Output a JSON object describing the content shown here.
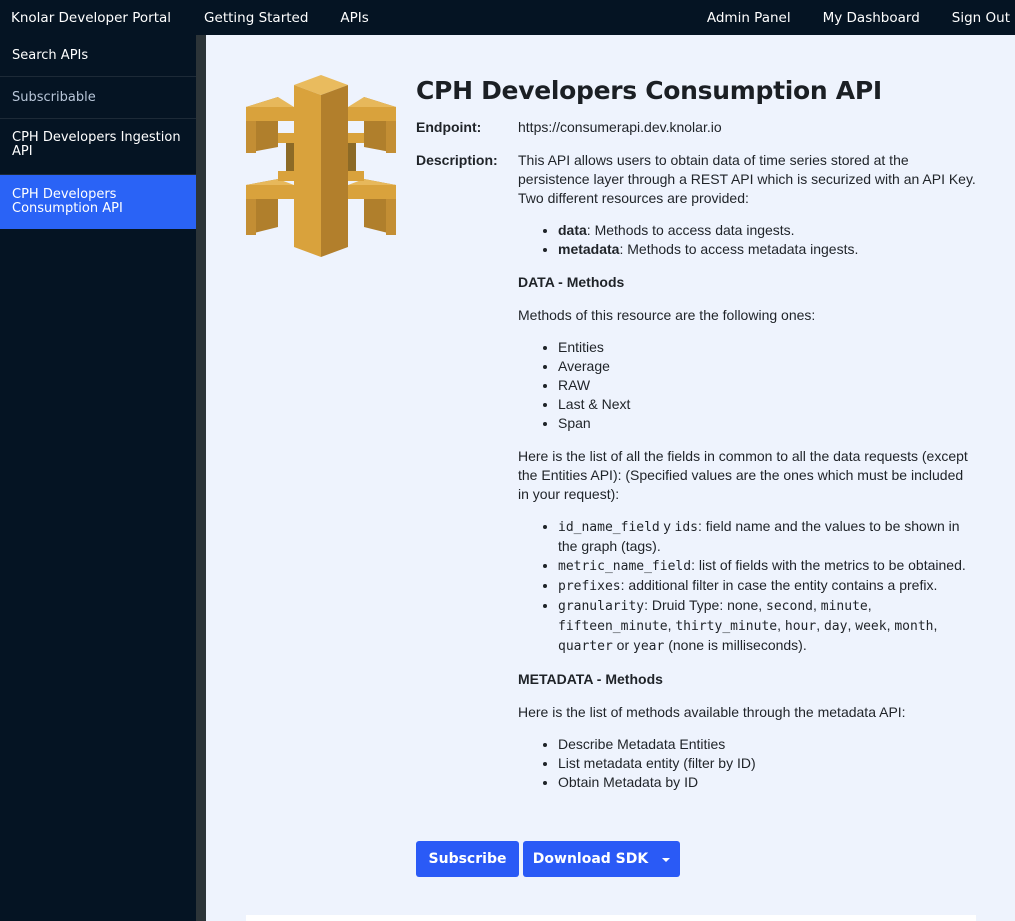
{
  "topnav": {
    "brand": "Knolar Developer Portal",
    "getting_started": "Getting Started",
    "apis": "APIs",
    "admin_panel": "Admin Panel",
    "my_dashboard": "My Dashboard",
    "sign_out": "Sign Out"
  },
  "sidebar": {
    "items": [
      {
        "label": "Search APIs",
        "active": false
      },
      {
        "label": "Subscribable",
        "active": false
      },
      {
        "label": "CPH Developers Ingestion API",
        "active": false
      },
      {
        "label": "CPH Developers Consumption API",
        "active": true
      }
    ]
  },
  "logo": {
    "icon": "api-gateway-icon",
    "color": "#d9a23c"
  },
  "api": {
    "title": "CPH Developers Consumption API",
    "endpoint_label": "Endpoint:",
    "endpoint_value": "https://consumerapi.dev.knolar.io",
    "description_label": "Description:",
    "description_intro": "This API allows users to obtain data of time series stored at the persistence layer through a REST API which is securized with an API Key. Two different resources are provided:",
    "resources": [
      {
        "name": "data",
        "text": ": Methods to access data ingests."
      },
      {
        "name": "metadata",
        "text": ": Methods to access metadata ingests."
      }
    ],
    "data_heading": "DATA - Methods",
    "data_methods_intro": "Methods of this resource are the following ones:",
    "data_methods": [
      "Entities",
      "Average",
      "RAW",
      "Last & Next",
      "Span"
    ],
    "fields_intro": "Here is the list of all the fields in common to all the data requests (except the Entities API): (Specified values are the ones which must be included in your request):",
    "fields": {
      "f1_code": "id_name_field",
      "f1_sep": " y ",
      "f1_code2": "ids",
      "f1_text": ": field name and the values to be shown in the graph (tags).",
      "f2_code": "metric_name_field",
      "f2_text": ": list of fields with the metrics to be obtained.",
      "f3_code": "prefixes",
      "f3_text": ": additional filter in case the entity contains a prefix.",
      "f4_code": "granularity",
      "f4_text": ": Druid Type: none, ",
      "f4_values": [
        "second",
        "minute",
        "fifteen_minute",
        "thirty_minute",
        "hour",
        "day",
        "week",
        "month",
        "quarter",
        "year"
      ],
      "sep_comma": ", ",
      "sep_or": " or ",
      "f4_tail": " (none is milliseconds)."
    },
    "metadata_heading": "METADATA - Methods",
    "metadata_intro": "Here is the list of methods available through the metadata API:",
    "metadata_methods": [
      "Describe Metadata Entities",
      "List metadata entity (filter by ID)",
      "Obtain Metadata by ID"
    ]
  },
  "buttons": {
    "subscribe": "Subscribe",
    "download_sdk": "Download SDK"
  },
  "colors": {
    "nav_bg": "#051423",
    "active": "#2a63f6",
    "button": "#2a5af6",
    "main_bg": "#eef3fd"
  }
}
